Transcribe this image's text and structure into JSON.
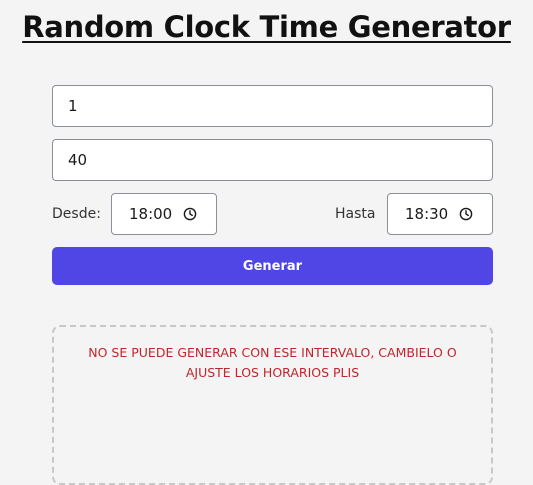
{
  "title": "Random Clock Time Generator",
  "form": {
    "count_value": "1",
    "minutes_value": "40",
    "from_label": "Desde:",
    "from_time": "18:00",
    "to_label": "Hasta",
    "to_time": "18:30",
    "generate_label": "Generar"
  },
  "results": {
    "error_message": "NO SE PUEDE GENERAR CON ESE INTERVALO, CAMBIELO O AJUSTE LOS HORARIOS PLIS"
  },
  "colors": {
    "background": "#f4f4f4",
    "button": "#5046e5",
    "error_text": "#c0262b"
  },
  "icons": {
    "time_picker": "clock-icon"
  }
}
